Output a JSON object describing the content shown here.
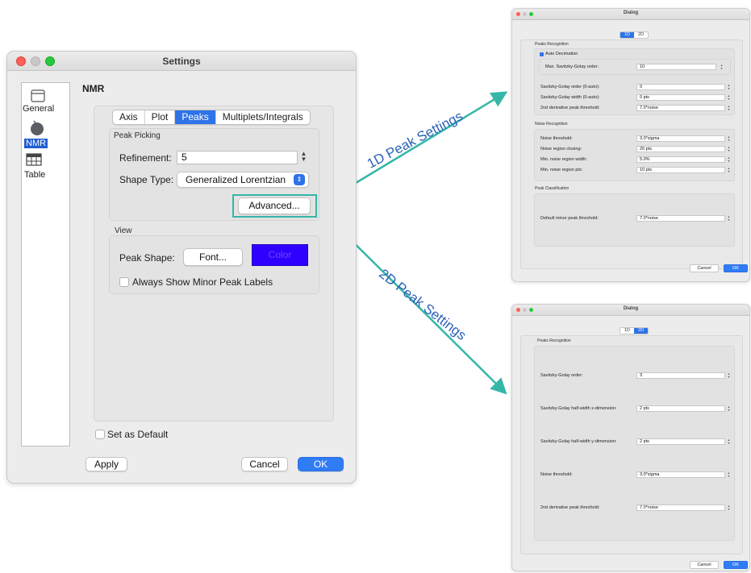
{
  "settings_window": {
    "title": "Settings",
    "sidebar": {
      "items": [
        {
          "label": "General",
          "icon": "window-icon"
        },
        {
          "label": "NMR",
          "icon": "nmr-magnet-icon",
          "selected": true
        },
        {
          "label": "Table",
          "icon": "table-icon"
        }
      ]
    },
    "section_title": "NMR",
    "tabs": [
      "Axis",
      "Plot",
      "Peaks",
      "Multiplets/Integrals"
    ],
    "active_tab": "Peaks",
    "peak_picking": {
      "group_label": "Peak Picking",
      "refinement_label": "Refinement:",
      "refinement_value": "5",
      "shape_type_label": "Shape Type:",
      "shape_type_value": "Generalized Lorentzian",
      "advanced_label": "Advanced..."
    },
    "view": {
      "group_label": "View",
      "peak_shape_label": "Peak Shape:",
      "font_label": "Font...",
      "color_label": "Color",
      "color_swatch": "#2f00ff",
      "always_show_label": "Always Show Minor Peak Labels",
      "always_show_checked": false
    },
    "set_default_label": "Set as Default",
    "set_default_checked": false,
    "apply_label": "Apply",
    "cancel_label": "Cancel",
    "ok_label": "OK"
  },
  "annotations": {
    "one_d": "1D Peak Settings",
    "two_d": "2D Peak Settings",
    "color": "#35b6a8"
  },
  "dialog_1d": {
    "title": "Dialog",
    "tabs": [
      "1D",
      "2D"
    ],
    "active_tab": "1D",
    "peaks_recognition": {
      "label": "Peaks Recognition",
      "auto_decimation_label": "Auto Decimation",
      "auto_decimation_checked": true,
      "max_sg_label": "Max. Savitzky-Golay order:",
      "max_sg_value": "10",
      "rows": [
        {
          "label": "Savitzky-Golay order (0-auto):",
          "value": "0"
        },
        {
          "label": "Savitzky-Golay width (0-auto):",
          "value": "0 pts"
        },
        {
          "label": "2nd derivative peak threshold:",
          "value": "7.0*noise"
        }
      ]
    },
    "noise_recognition": {
      "label": "Noise Recognition",
      "rows": [
        {
          "label": "Noise threshold:",
          "value": "3.0*sigma"
        },
        {
          "label": "Noise region closing:",
          "value": "20 pts"
        },
        {
          "label": "Min. noise region width:",
          "value": "5.0%"
        },
        {
          "label": "Min. noise region pts:",
          "value": "10 pts"
        }
      ]
    },
    "peak_classification": {
      "label": "Peak Classification",
      "rows": [
        {
          "label": "Default minor peak threshold:",
          "value": "7.0*noise"
        }
      ]
    },
    "cancel_label": "Cancel",
    "ok_label": "OK"
  },
  "dialog_2d": {
    "title": "Dialog",
    "tabs": [
      "1D",
      "2D"
    ],
    "active_tab": "2D",
    "peaks_recognition": {
      "label": "Peaks Recognition",
      "rows": [
        {
          "label": "Savitzky-Golay order:",
          "value": "3"
        },
        {
          "label": "Savitzky-Golay half-width x-dimension:",
          "value": "2 pts"
        },
        {
          "label": "Savitzky-Golay half-width y-dimension:",
          "value": "2 pts"
        },
        {
          "label": "Noise threshold:",
          "value": "3.0*sigma"
        },
        {
          "label": "2nd derivative peak threshold:",
          "value": "7.0*noise"
        }
      ]
    },
    "cancel_label": "Cancel",
    "ok_label": "OK"
  }
}
